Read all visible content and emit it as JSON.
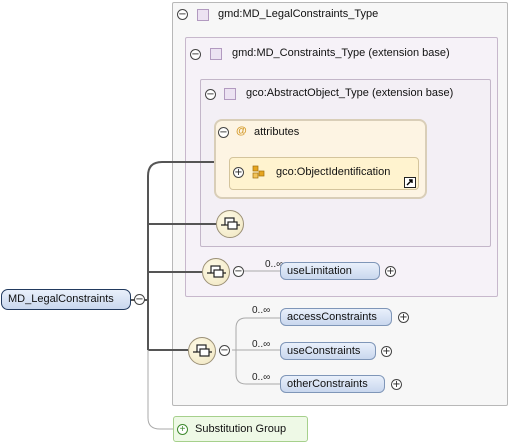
{
  "diagram": {
    "root": {
      "label": "MD_LegalConstraints"
    },
    "type_box": {
      "label": "gmd:MD_LegalConstraints_Type"
    },
    "extension_1": {
      "label": "gmd:MD_Constraints_Type (extension base)"
    },
    "extension_2": {
      "label": "gco:AbstractObject_Type (extension base)"
    },
    "attributes": {
      "icon": "@",
      "label": "attributes",
      "item": {
        "label": "gco:ObjectIdentification"
      }
    },
    "use_limitation": {
      "cardinality": "0..∞",
      "label": "useLimitation"
    },
    "choice_elements": [
      {
        "cardinality": "0..∞",
        "label": "accessConstraints"
      },
      {
        "cardinality": "0..∞",
        "label": "useConstraints"
      },
      {
        "cardinality": "0..∞",
        "label": "otherConstraints"
      }
    ],
    "substitution_group": {
      "label": "Substitution Group"
    },
    "toggles": {
      "collapse": "⊖",
      "expand": "⊕"
    },
    "colors": {
      "root_border": "#223a5e",
      "element_fill": "#c9d7ee",
      "attribute_fill": "#fdf4e3",
      "substitution_fill": "#eef9e6"
    }
  }
}
